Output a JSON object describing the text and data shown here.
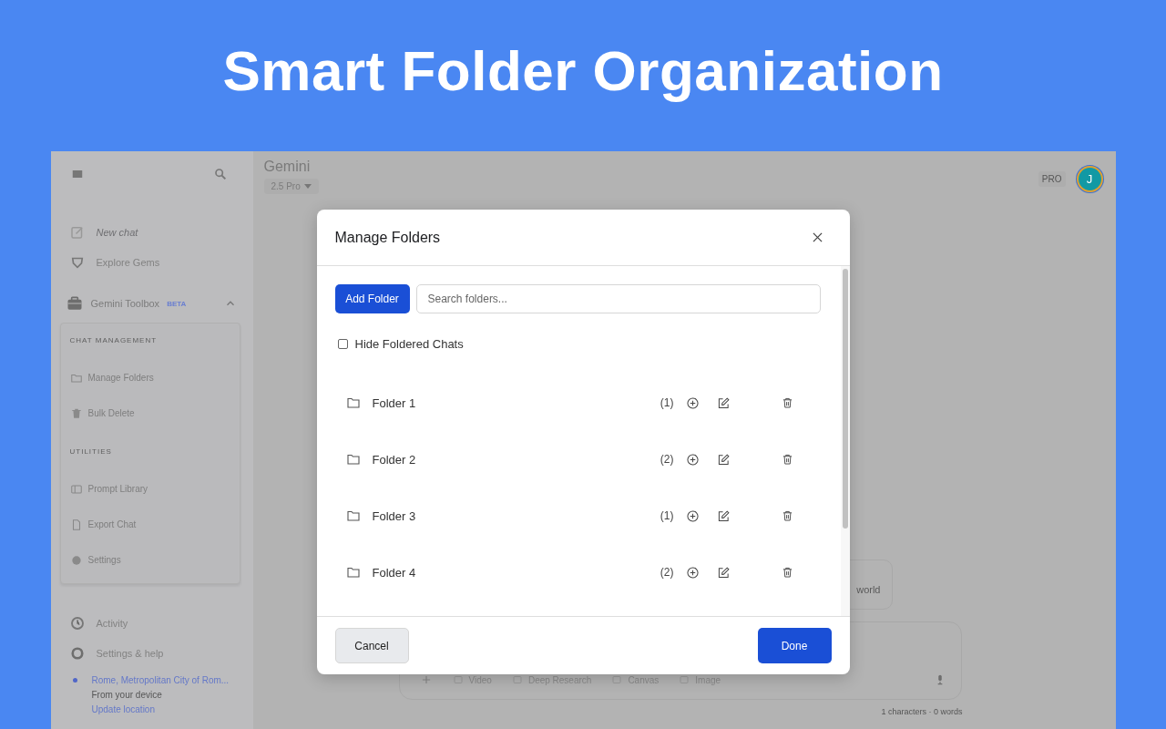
{
  "headline": "Smart Folder Organization",
  "sidebar": {
    "items": [
      {
        "label": "New chat",
        "disabled": true
      },
      {
        "label": "Explore Gems",
        "disabled": false
      }
    ],
    "toolbox": {
      "title": "Gemini Toolbox",
      "badge": "BETA",
      "expanded": true,
      "sections": [
        {
          "heading": "CHAT MANAGEMENT",
          "items": [
            "Manage Folders",
            "Bulk Delete"
          ]
        },
        {
          "heading": "UTILITIES",
          "items": [
            "Prompt Library",
            "Export Chat",
            "Settings"
          ]
        }
      ]
    },
    "footer_items": [
      "Activity",
      "Settings & help"
    ],
    "location": {
      "place": "Rome, Metropolitan City of Rom...",
      "source": "From your device",
      "link": "Update location"
    }
  },
  "header": {
    "title": "Gemini",
    "model": "2.5 Pro",
    "plan_badge": "PRO",
    "avatar_initial": "J"
  },
  "suggestion": {
    "text": "world"
  },
  "composer": {
    "tools": [
      "Video",
      "Deep Research",
      "Canvas",
      "Image"
    ],
    "counter": "1 characters · 0 words"
  },
  "dialog": {
    "title": "Manage Folders",
    "add_button": "Add Folder",
    "search": {
      "placeholder": "Search folders..."
    },
    "hide_option": {
      "label": "Hide Foldered Chats",
      "checked": false
    },
    "folders": [
      {
        "name": "Folder 1",
        "count": "(1)"
      },
      {
        "name": "Folder 2",
        "count": "(2)"
      },
      {
        "name": "Folder 3",
        "count": "(1)"
      },
      {
        "name": "Folder 4",
        "count": "(2)"
      }
    ],
    "cancel": "Cancel",
    "done": "Done"
  }
}
